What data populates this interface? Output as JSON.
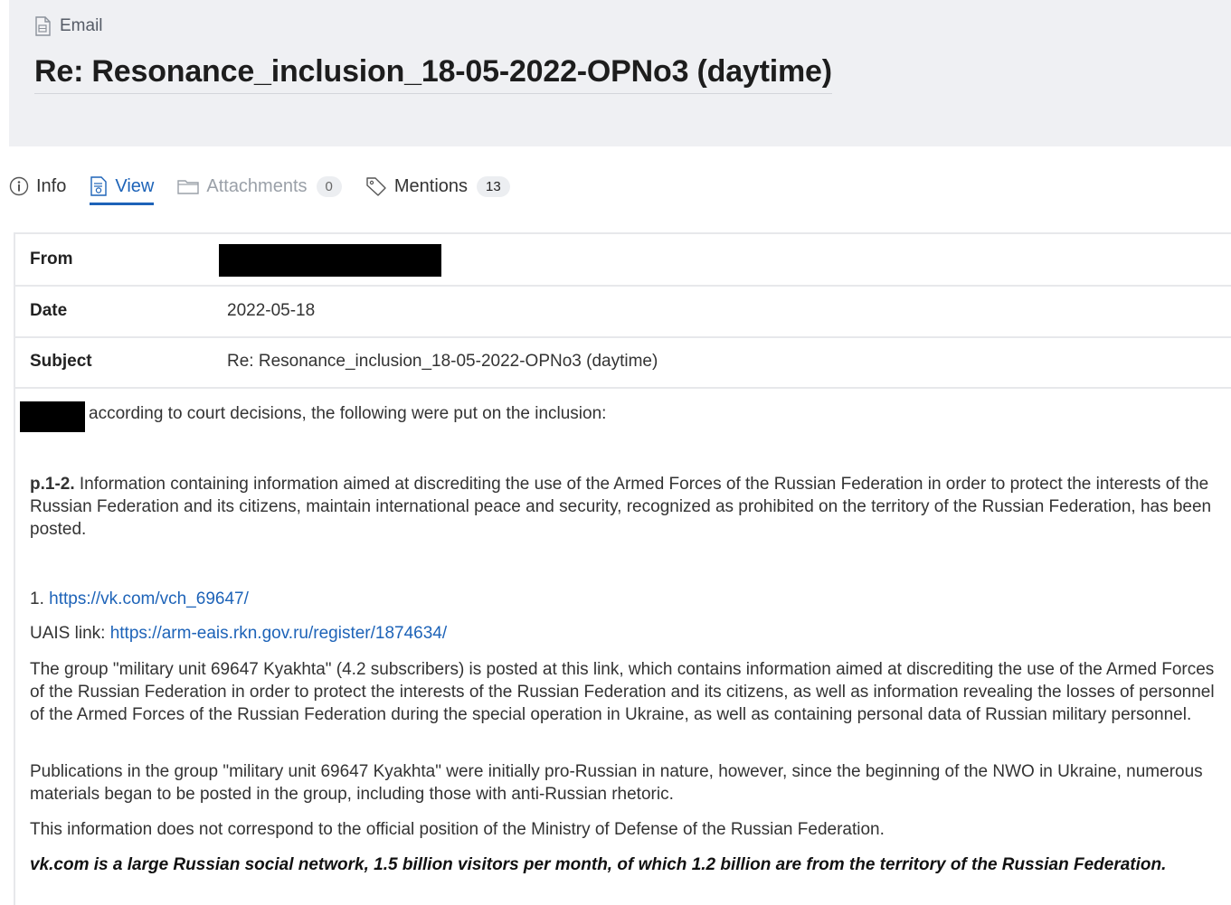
{
  "header": {
    "breadcrumb": "Email",
    "title": "Re: Resonance_inclusion_18-05-2022-OPNo3 (daytime)"
  },
  "tabs": [
    {
      "label": "Info"
    },
    {
      "label": "View"
    },
    {
      "label": "Attachments",
      "count": "0"
    },
    {
      "label": "Mentions",
      "count": "13"
    }
  ],
  "fields": {
    "from_label": "From",
    "date_label": "Date",
    "date_value": "2022-05-18",
    "subject_label": "Subject",
    "subject_value": "Re: Resonance_inclusion_18-05-2022-OPNo3 (daytime)"
  },
  "body": {
    "intro": "according to court decisions, the following were put on the inclusion:",
    "p_label": "p.1-2.",
    "p_text": " Information containing information aimed at discrediting the use of the Armed Forces of the Russian Federation in order to protect the interests of the Russian Federation and its citizens, maintain international peace and security, recognized as prohibited on the territory of the Russian Federation, has been posted.",
    "item_number": "1.",
    "item_link": "https://vk.com/vch_69647/",
    "uais_label": "UAIS link:",
    "uais_link": "https://arm-eais.rkn.gov.ru/register/1874634/",
    "para1": "The group \"military unit 69647 Kyakhta\" (4.2 subscribers) is posted at this link, which contains information aimed at discrediting the use of the Armed Forces of the Russian Federation in order to protect the interests of the Russian Federation and its citizens, as well as information revealing the losses of personnel of the Armed Forces of the Russian Federation during the special operation in Ukraine, as well as containing personal data of Russian military personnel.",
    "para2": "Publications in the group \"military unit 69647 Kyakhta\" were initially pro-Russian in nature, however, since the beginning of the NWO in Ukraine, numerous materials began to be posted in the group, including those with anti-Russian rhetoric.",
    "para3": "This information does not correspond to the official position of the Ministry of Defense of the Russian Federation.",
    "para4": "vk.com is a large Russian social network, 1.5 billion visitors per month, of which 1.2 billion are from the territory of the Russian Federation."
  },
  "colors": {
    "accent": "#1d63b8",
    "header_bg": "#eff0f3"
  },
  "icons": [
    "document-icon",
    "info-icon",
    "view-icon",
    "folder-icon",
    "tag-icon"
  ]
}
